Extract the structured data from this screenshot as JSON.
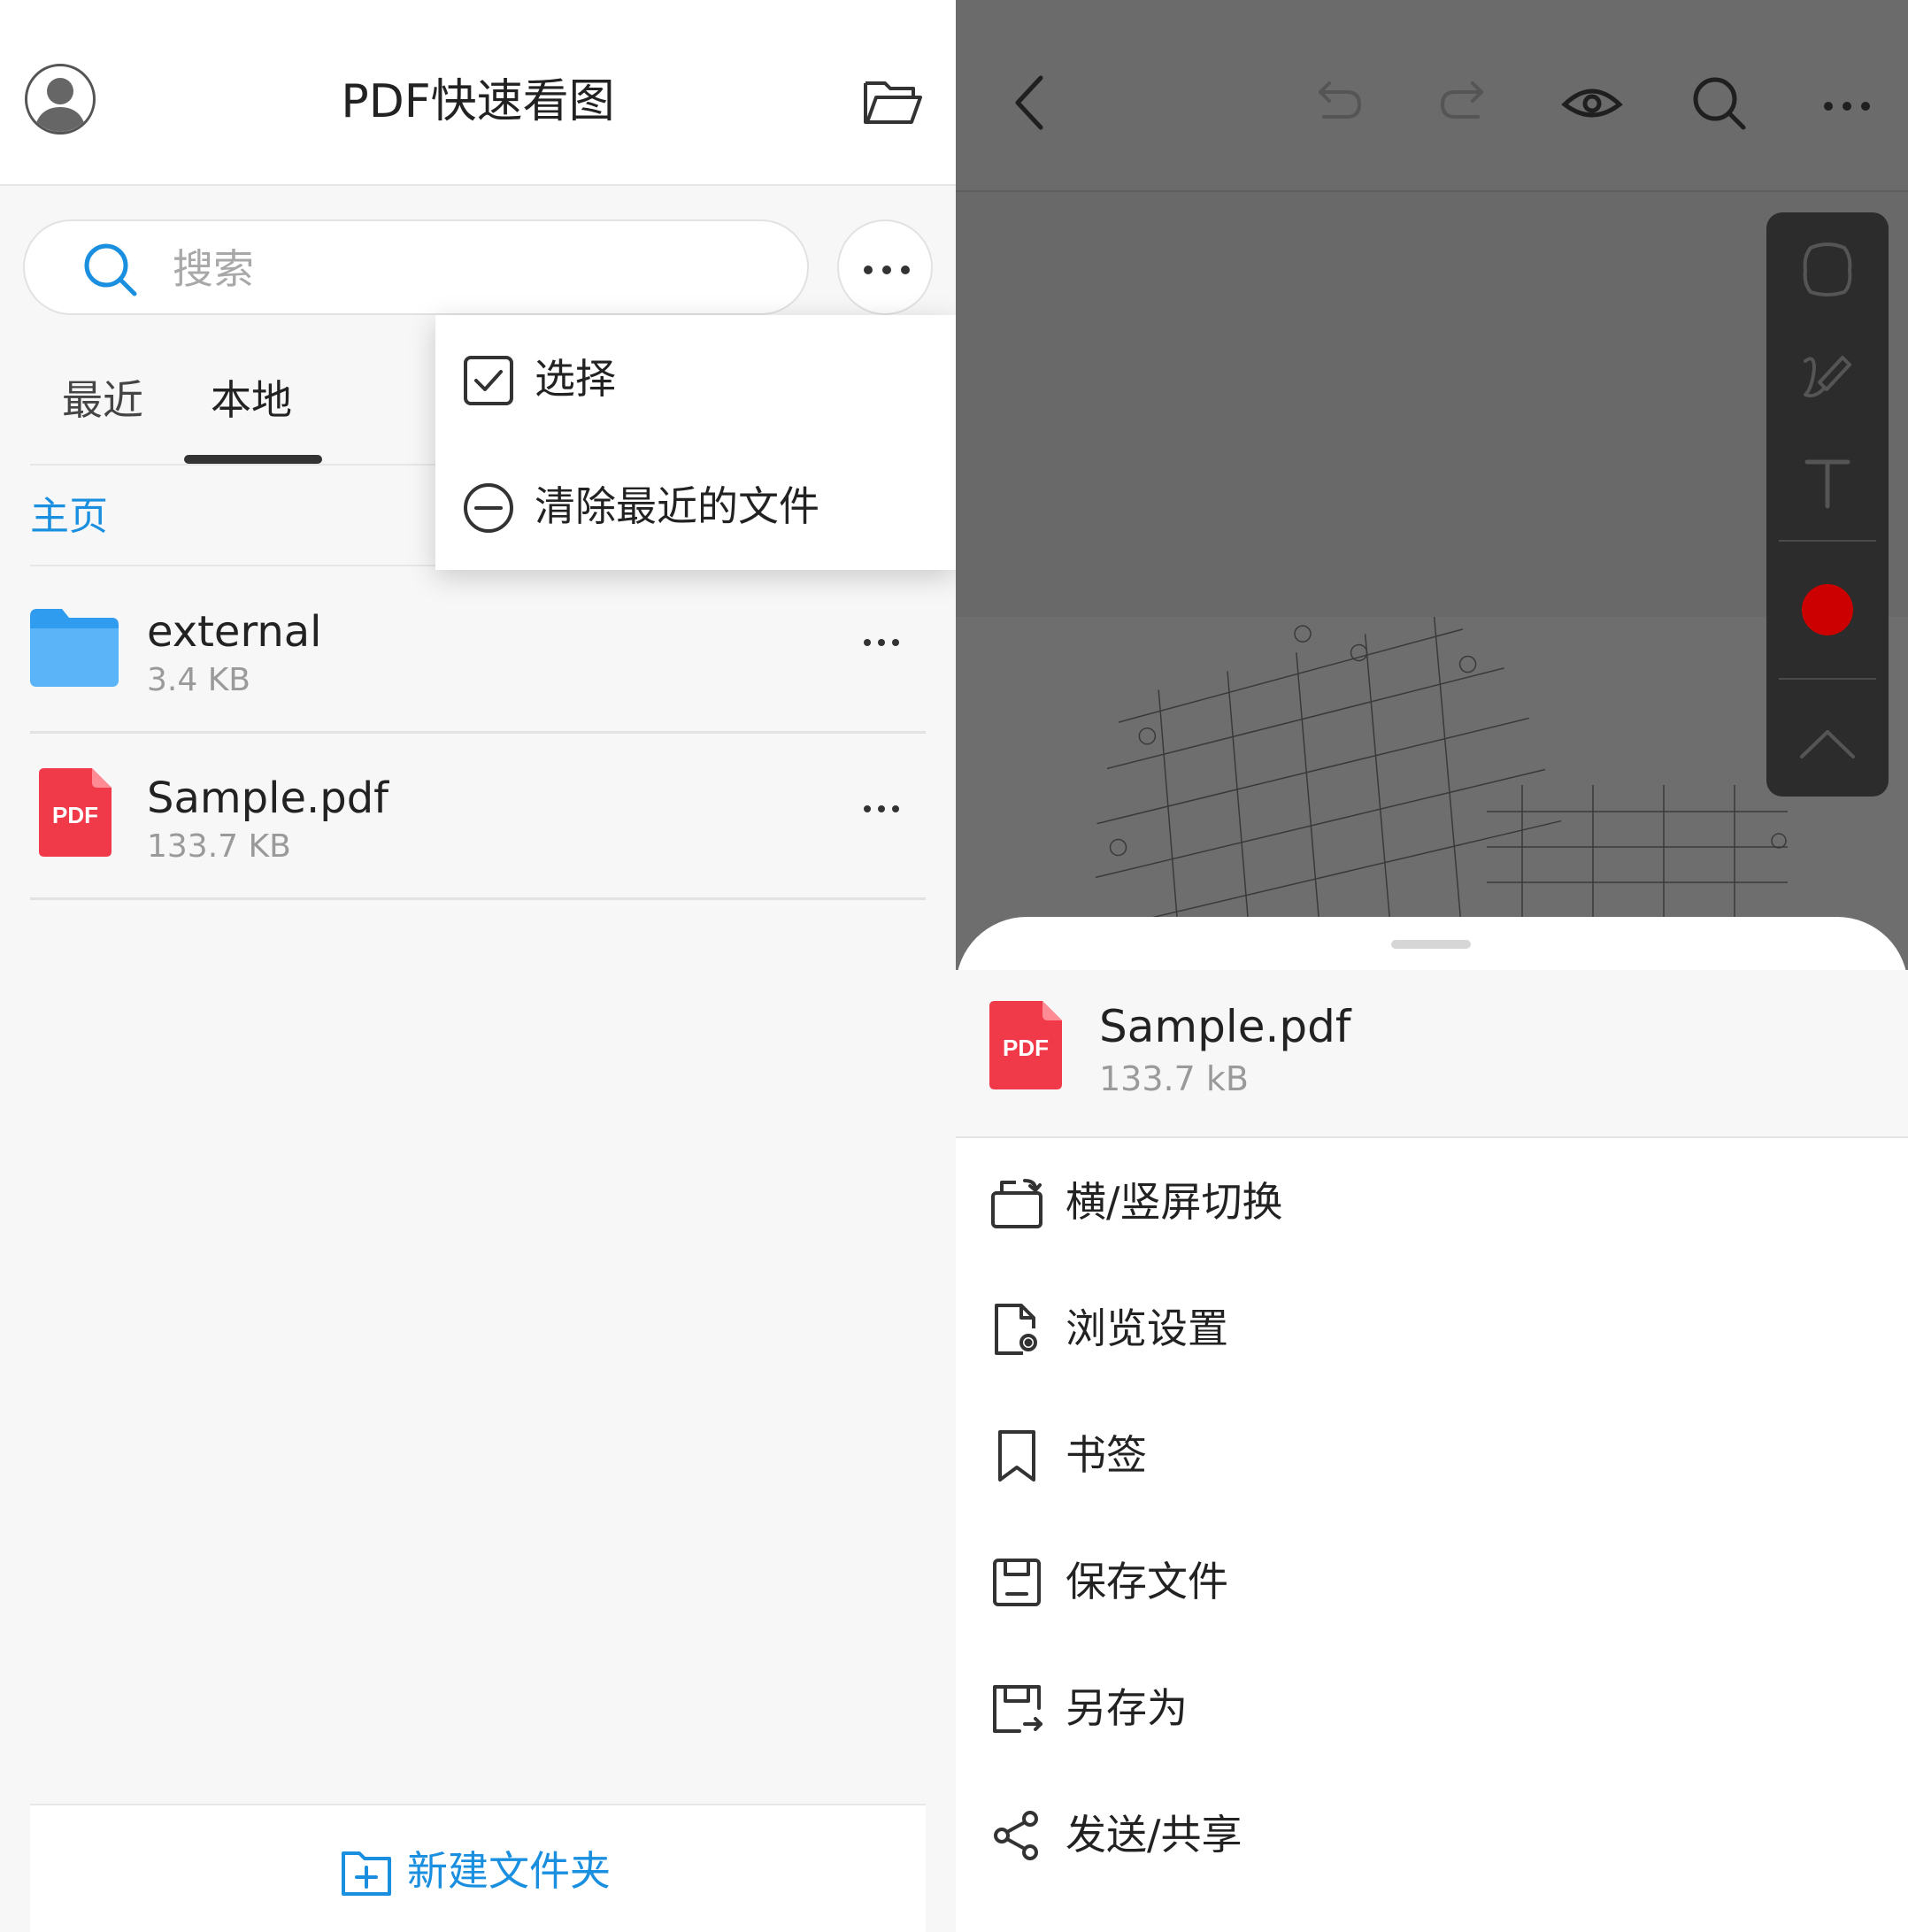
{
  "left": {
    "header": {
      "title": "PDF快速看图"
    },
    "search": {
      "placeholder": "搜索"
    },
    "tabs": [
      {
        "label": "最近"
      },
      {
        "label": "本地"
      }
    ],
    "breadcrumb": "主页",
    "files": [
      {
        "name": "external",
        "size": "3.4 KB",
        "icon": "folder-icon"
      },
      {
        "name": "Sample.pdf",
        "size": "133.7 KB",
        "icon": "pdf-file-icon",
        "icon_text": "PDF"
      }
    ],
    "popup_menu": [
      {
        "label": "选择",
        "icon": "checkbox-icon"
      },
      {
        "label": "清除最近的文件",
        "icon": "minus-circle-icon"
      }
    ],
    "new_folder_label": "新建文件夹"
  },
  "right": {
    "sheet": {
      "file_name": "Sample.pdf",
      "file_size": "133.7 kB",
      "icon_text": "PDF",
      "menu": [
        {
          "label": "横/竖屏切换",
          "icon": "rotate-screen-icon"
        },
        {
          "label": "浏览设置",
          "icon": "view-settings-icon"
        },
        {
          "label": "书签",
          "icon": "bookmark-icon"
        },
        {
          "label": "保存文件",
          "icon": "save-icon"
        },
        {
          "label": "另存为",
          "icon": "save-as-icon"
        },
        {
          "label": "发送/共享",
          "icon": "share-icon"
        }
      ]
    },
    "annotation_color": "#cc0000"
  },
  "colors": {
    "accent": "#1a8fe0",
    "pdf_red": "#f03a4a",
    "folder_blue": "#2f9cf0"
  }
}
